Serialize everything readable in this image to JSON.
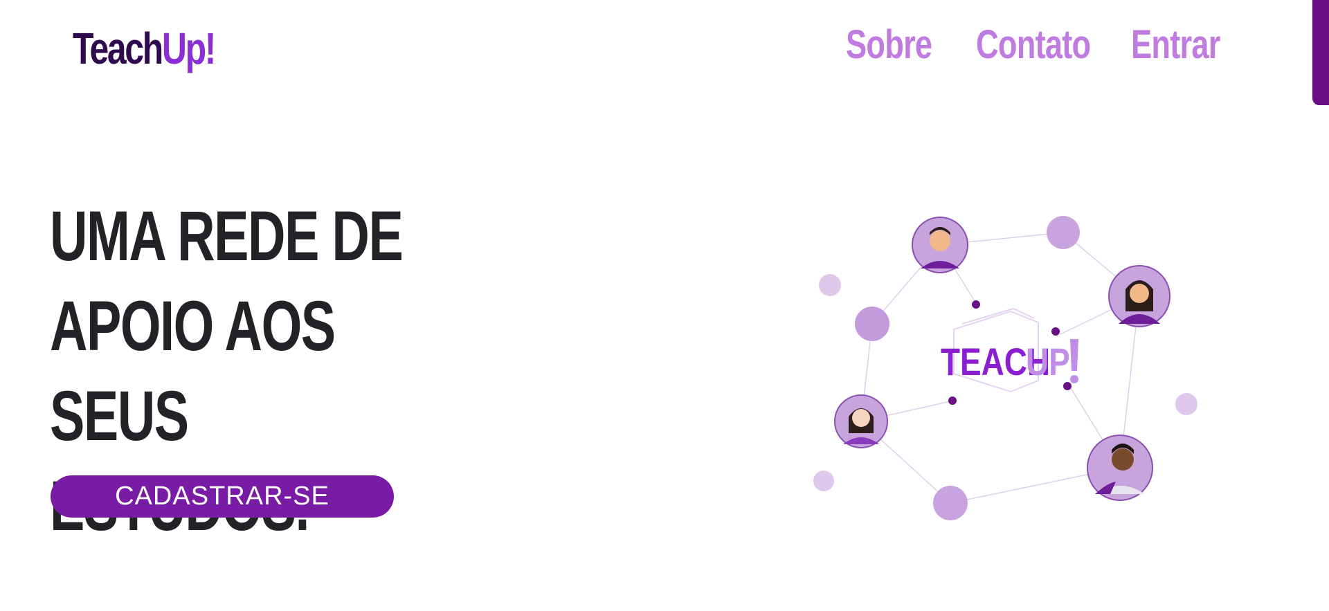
{
  "header": {
    "logo_part1": "Teach",
    "logo_part2": "Up!",
    "nav": [
      "Sobre",
      "Contato",
      "Entrar"
    ]
  },
  "hero": {
    "title_lines": [
      "UMA REDE DE",
      "APOIO AOS SEUS",
      "ESTUDOS."
    ],
    "cta_label": "CADASTRAR-SE"
  },
  "illustration": {
    "label_part1": "TEACH",
    "label_part2": "UP"
  },
  "colors": {
    "brand_dark": "#2f0a4f",
    "brand_purple": "#8a2ed6",
    "nav_link": "#c07be0",
    "button": "#7a1ba6",
    "scrollbar": "#6b0f84",
    "title": "#222326"
  }
}
